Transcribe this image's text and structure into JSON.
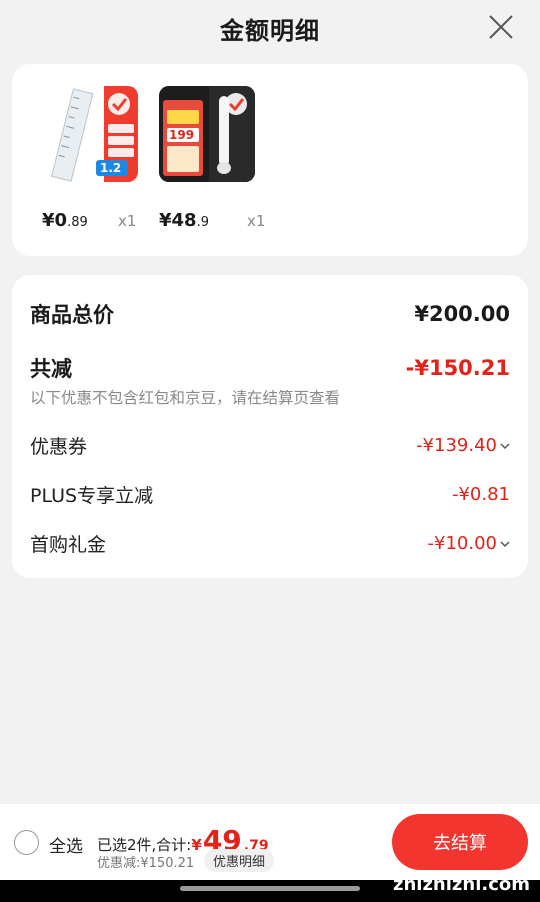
{
  "header": {
    "title": "金额明细"
  },
  "products": [
    {
      "price_int": "¥0",
      "price_dec": ".89",
      "qty": "x1",
      "badge": "1.2"
    },
    {
      "price_int": "¥48",
      "price_dec": ".9",
      "qty": "x1",
      "badge": "199"
    }
  ],
  "summary": {
    "total_label": "商品总价",
    "total_value": "¥200.00",
    "reduce_label": "共减",
    "reduce_value": "-¥150.21",
    "note": "以下优惠不包含红包和京豆，请在结算页查看",
    "items": [
      {
        "label": "优惠券",
        "value": "-¥139.40"
      },
      {
        "label": "PLUS专享立减",
        "value": "-¥0.81"
      },
      {
        "label": "首购礼金",
        "value": "-¥10.00"
      }
    ]
  },
  "bottom": {
    "select_all": "全选",
    "selected_prefix": "已选2件,合计:",
    "currency": "¥",
    "total_int": "49",
    "total_dec": ".79",
    "discount_text": "优惠减:¥150.21",
    "detail_chip": "优惠明细",
    "checkout": "去结算"
  },
  "watermark": "zhizhizhi.com",
  "colors": {
    "accent_red": "#e2231a",
    "background": "#f2f2f2"
  }
}
